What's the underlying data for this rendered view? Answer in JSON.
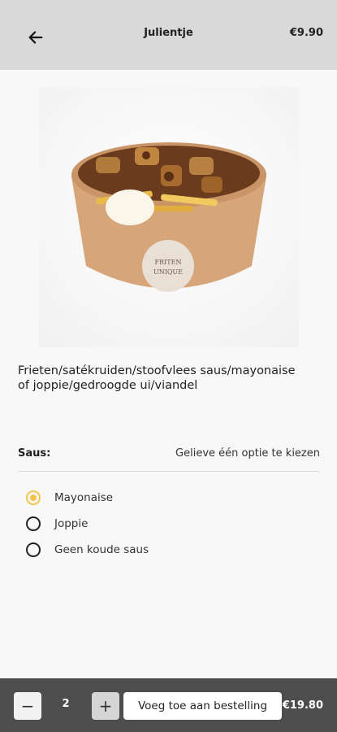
{
  "header": {
    "title": "Julientje",
    "price": "€9.90",
    "back_icon": "arrow-left-icon"
  },
  "product": {
    "image_icon": "fries-bowl-image",
    "logo_text_line1": "FRITEN",
    "logo_text_line2": "UNIQUE",
    "description": "Frieten/satékruiden/stoofvlees saus/mayonaise of joppie/gedroogde ui/viandel"
  },
  "sauce": {
    "label": "Saus:",
    "hint": "Gelieve één optie te kiezen",
    "options": [
      {
        "label": "Mayonaise",
        "selected": true
      },
      {
        "label": "Joppie",
        "selected": false
      },
      {
        "label": "Geen koude saus",
        "selected": false
      }
    ]
  },
  "footer": {
    "minus_label": "−",
    "quantity": "2",
    "plus_label": "+",
    "add_label": "Voeg toe aan bestelling",
    "total": "€19.80"
  },
  "colors": {
    "accent": "#f5c44e",
    "header_bg": "#d9d9d9",
    "footer_bg": "#4d4d4d"
  }
}
